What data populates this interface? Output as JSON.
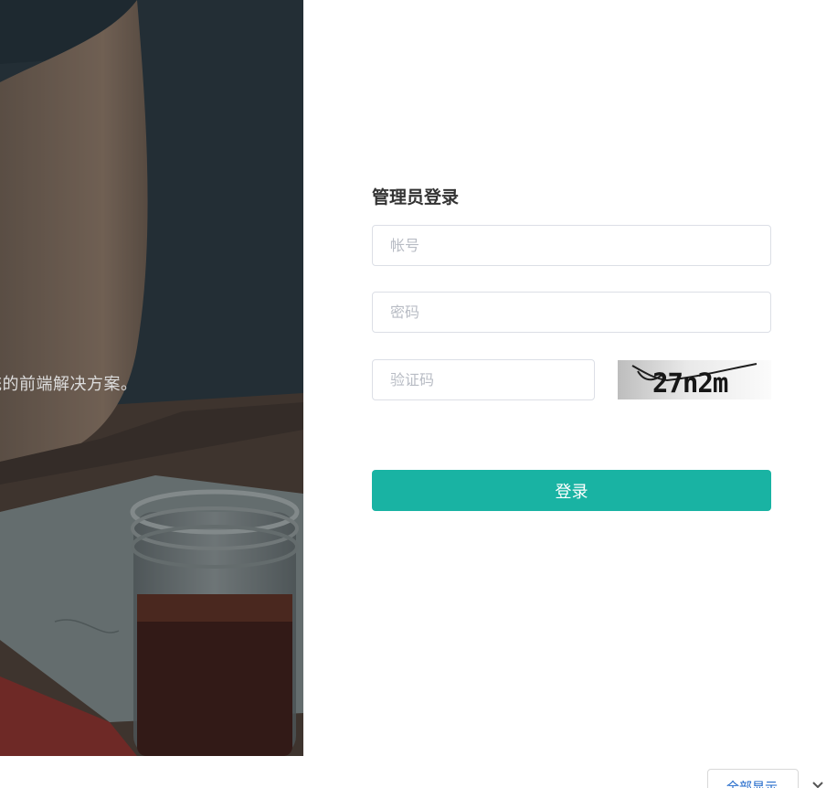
{
  "photo": {
    "caption": "统的前端解决方案。"
  },
  "login": {
    "title": "管理员登录",
    "account_placeholder": "帐号",
    "password_placeholder": "密码",
    "captcha_placeholder": "验证码",
    "captcha_code": "27n2m",
    "submit_label": "登录"
  },
  "footer": {
    "show_all_label": "全部显示",
    "close_icon": "close-icon"
  },
  "colors": {
    "accent": "#19b3a3",
    "link": "#1a64c8",
    "title_text": "#333333",
    "input_border": "#dcdfe6"
  }
}
